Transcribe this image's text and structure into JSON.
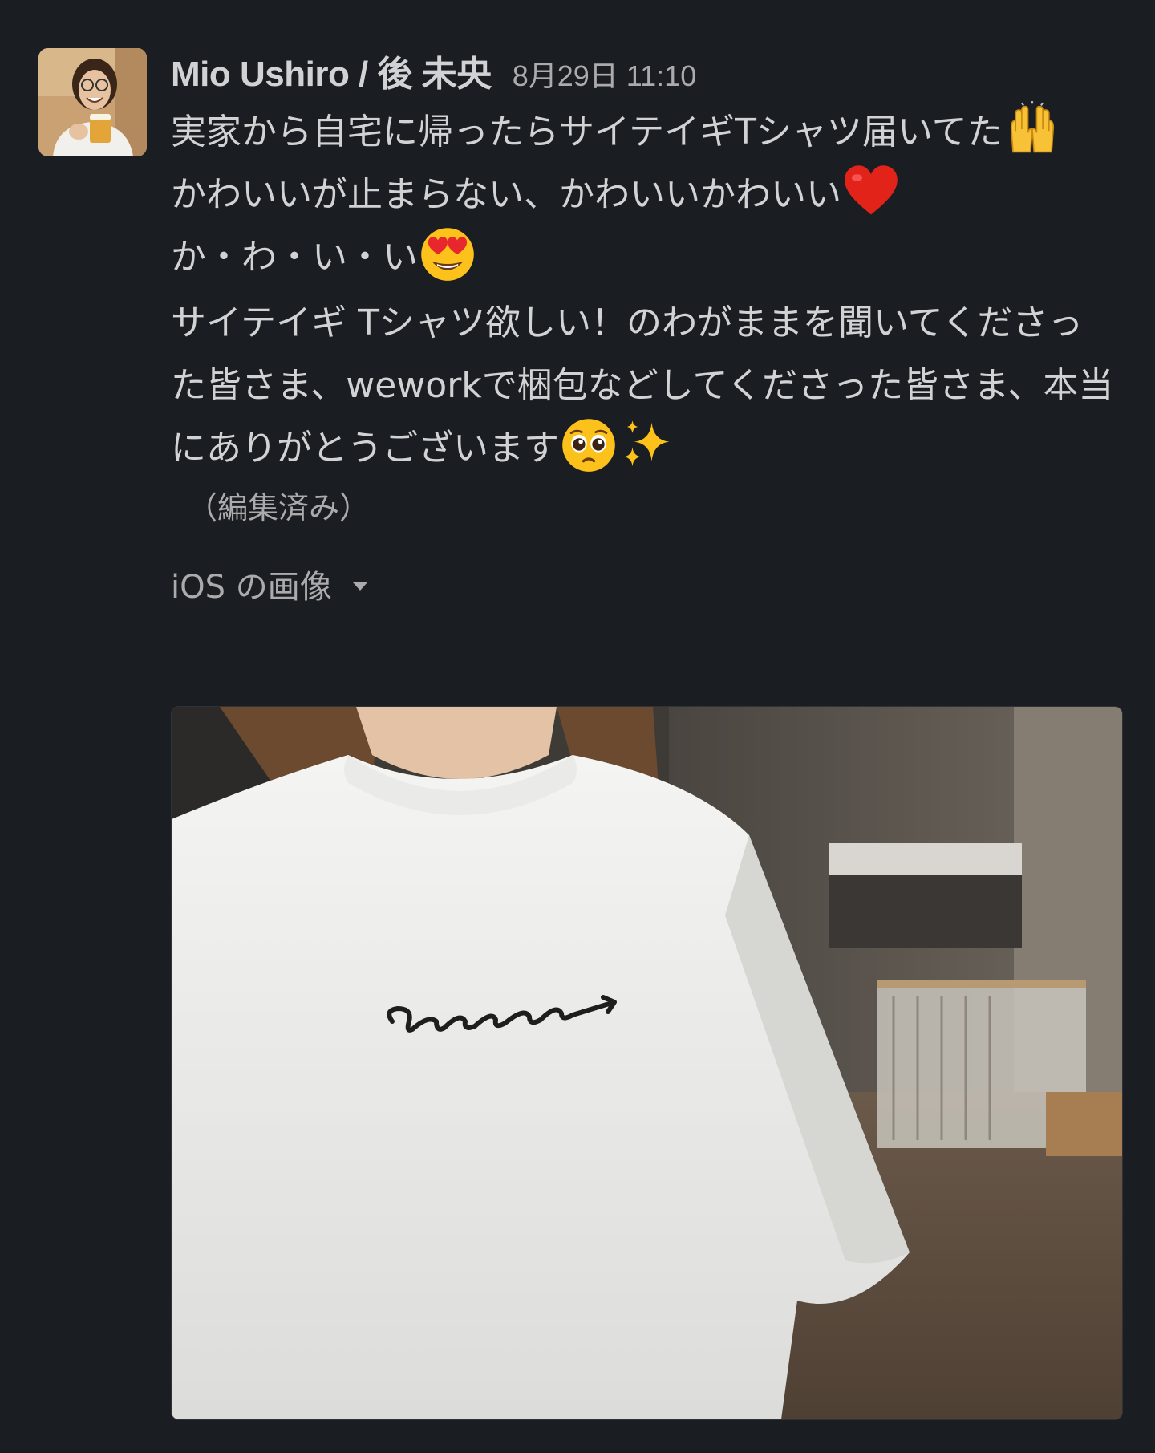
{
  "message": {
    "author": "Mio Ushiro / 後 未央",
    "timestamp": "8月29日 11:10",
    "lines": [
      "実家から自宅に帰ったらサイテイギTシャツ届いてた",
      "かわいいが止まらない、かわいいかわいい",
      "か・わ・い・い"
    ],
    "paragraph2": "サイテイギ Tシャツ欲しい！のわがままを聞いてくださった皆さま、weworkで梱包などしてくださった皆さま、本当にありがとうございます",
    "edited": "（編集済み）",
    "emojis": [
      "raising-hands",
      "red-heart",
      "heart-eyes",
      "pleading-face",
      "sparkles"
    ]
  },
  "attachment": {
    "label": "iOS の画像",
    "image_description": "white t-shirt with cursive logo"
  },
  "colors": {
    "background": "#1a1d21",
    "text": "#d1d2d3",
    "muted": "#ababad"
  }
}
